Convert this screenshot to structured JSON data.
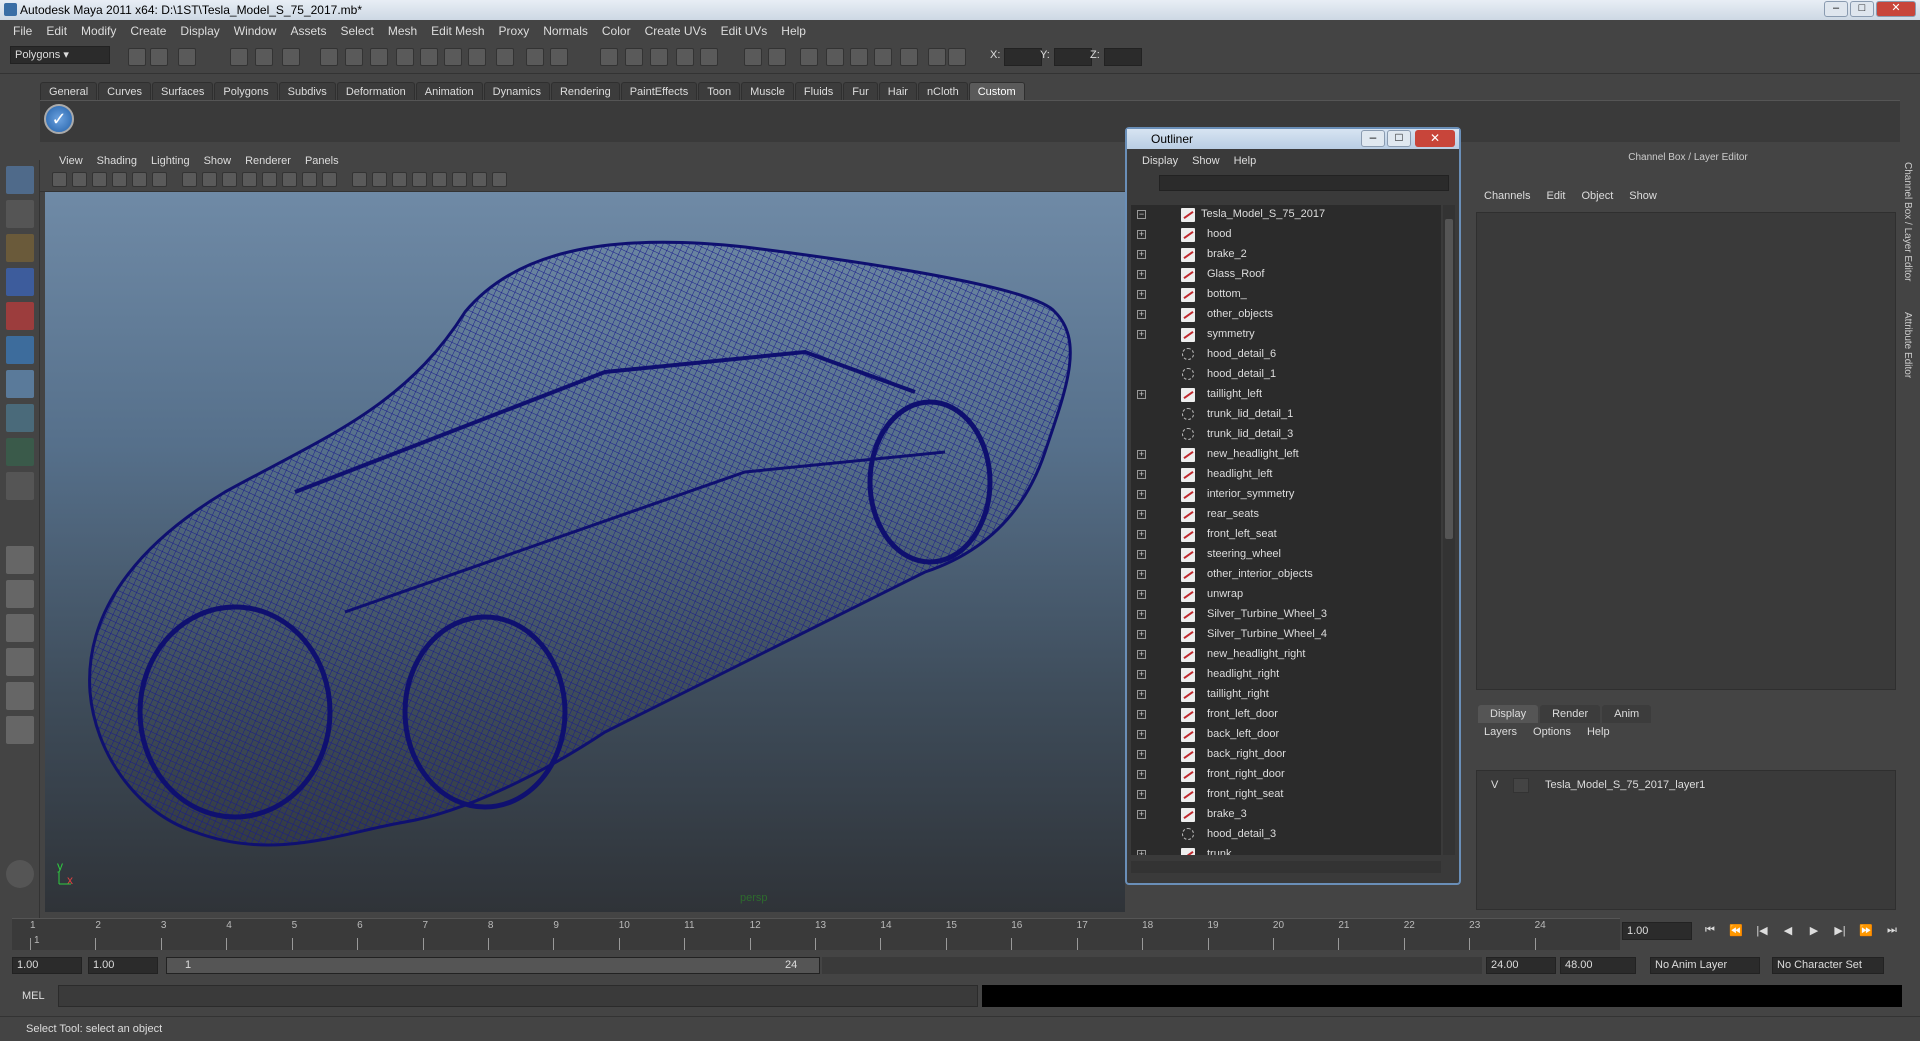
{
  "window": {
    "title": "Autodesk Maya 2011 x64: D:\\1ST\\Tesla_Model_S_75_2017.mb*"
  },
  "menubar": [
    "File",
    "Edit",
    "Modify",
    "Create",
    "Display",
    "Window",
    "Assets",
    "Select",
    "Mesh",
    "Edit Mesh",
    "Proxy",
    "Normals",
    "Color",
    "Create UVs",
    "Edit UVs",
    "Help"
  ],
  "statusline": {
    "mode": "Polygons",
    "x_label": "X:",
    "y_label": "Y:",
    "z_label": "Z:"
  },
  "shelf": {
    "tabs": [
      "General",
      "Curves",
      "Surfaces",
      "Polygons",
      "Subdivs",
      "Deformation",
      "Animation",
      "Dynamics",
      "Rendering",
      "PaintEffects",
      "Toon",
      "Muscle",
      "Fluids",
      "Fur",
      "Hair",
      "nCloth",
      "Custom"
    ],
    "active_tab": "Custom"
  },
  "viewport": {
    "menu": [
      "View",
      "Shading",
      "Lighting",
      "Show",
      "Renderer",
      "Panels"
    ],
    "camera_label": "persp",
    "axis_y": "y",
    "axis_x": "x",
    "wire_color": "#0f1070"
  },
  "outliner": {
    "title": "Outliner",
    "menu": [
      "Display",
      "Show",
      "Help"
    ],
    "root": "Tesla_Model_S_75_2017",
    "items": [
      {
        "label": "hood",
        "group": false
      },
      {
        "label": "brake_2",
        "group": false
      },
      {
        "label": "Glass_Roof",
        "group": false
      },
      {
        "label": "bottom_",
        "group": false
      },
      {
        "label": "other_objects",
        "group": false
      },
      {
        "label": "symmetry",
        "group": false
      },
      {
        "label": "hood_detail_6",
        "group": true
      },
      {
        "label": "hood_detail_1",
        "group": true
      },
      {
        "label": "taillight_left",
        "group": false
      },
      {
        "label": "trunk_lid_detail_1",
        "group": true
      },
      {
        "label": "trunk_lid_detail_3",
        "group": true
      },
      {
        "label": "new_headlight_left",
        "group": false
      },
      {
        "label": "headlight_left",
        "group": false
      },
      {
        "label": "interior_symmetry",
        "group": false
      },
      {
        "label": "rear_seats",
        "group": false
      },
      {
        "label": "front_left_seat",
        "group": false
      },
      {
        "label": "steering_wheel",
        "group": false
      },
      {
        "label": "other_interior_objects",
        "group": false
      },
      {
        "label": "unwrap",
        "group": false
      },
      {
        "label": "Silver_Turbine_Wheel_3",
        "group": false
      },
      {
        "label": "Silver_Turbine_Wheel_4",
        "group": false
      },
      {
        "label": "new_headlight_right",
        "group": false
      },
      {
        "label": "headlight_right",
        "group": false
      },
      {
        "label": "taillight_right",
        "group": false
      },
      {
        "label": "front_left_door",
        "group": false
      },
      {
        "label": "back_left_door",
        "group": false
      },
      {
        "label": "back_right_door",
        "group": false
      },
      {
        "label": "front_right_door",
        "group": false
      },
      {
        "label": "front_right_seat",
        "group": false
      },
      {
        "label": "brake_3",
        "group": false
      },
      {
        "label": "hood_detail_3",
        "group": true
      },
      {
        "label": "trunk",
        "group": false
      }
    ]
  },
  "channel_box": {
    "title": "Channel Box / Layer Editor",
    "menu": [
      "Channels",
      "Edit",
      "Object",
      "Show"
    ],
    "side_tabs": [
      "Channel Box / Layer Editor",
      "Attribute Editor"
    ]
  },
  "layer_editor": {
    "tabs": [
      "Display",
      "Render",
      "Anim"
    ],
    "active_tab": "Display",
    "menu": [
      "Layers",
      "Options",
      "Help"
    ],
    "layer": {
      "visible": "V",
      "name": "Tesla_Model_S_75_2017_layer1"
    }
  },
  "timeline": {
    "ticks": [
      "1",
      "2",
      "3",
      "4",
      "5",
      "6",
      "7",
      "8",
      "9",
      "10",
      "11",
      "12",
      "13",
      "14",
      "15",
      "16",
      "17",
      "18",
      "19",
      "20",
      "21",
      "22",
      "23",
      "24"
    ],
    "current_frame": "1.00",
    "playhead_label": "1"
  },
  "range": {
    "start": "1.00",
    "playback_start": "1.00",
    "slider_start": "1",
    "slider_end": "24",
    "playback_end": "24.00",
    "end": "48.00",
    "anim_layer": "No Anim Layer",
    "character_set": "No Character Set"
  },
  "command_line": {
    "label": "MEL"
  },
  "help_line": "Select Tool: select an object"
}
